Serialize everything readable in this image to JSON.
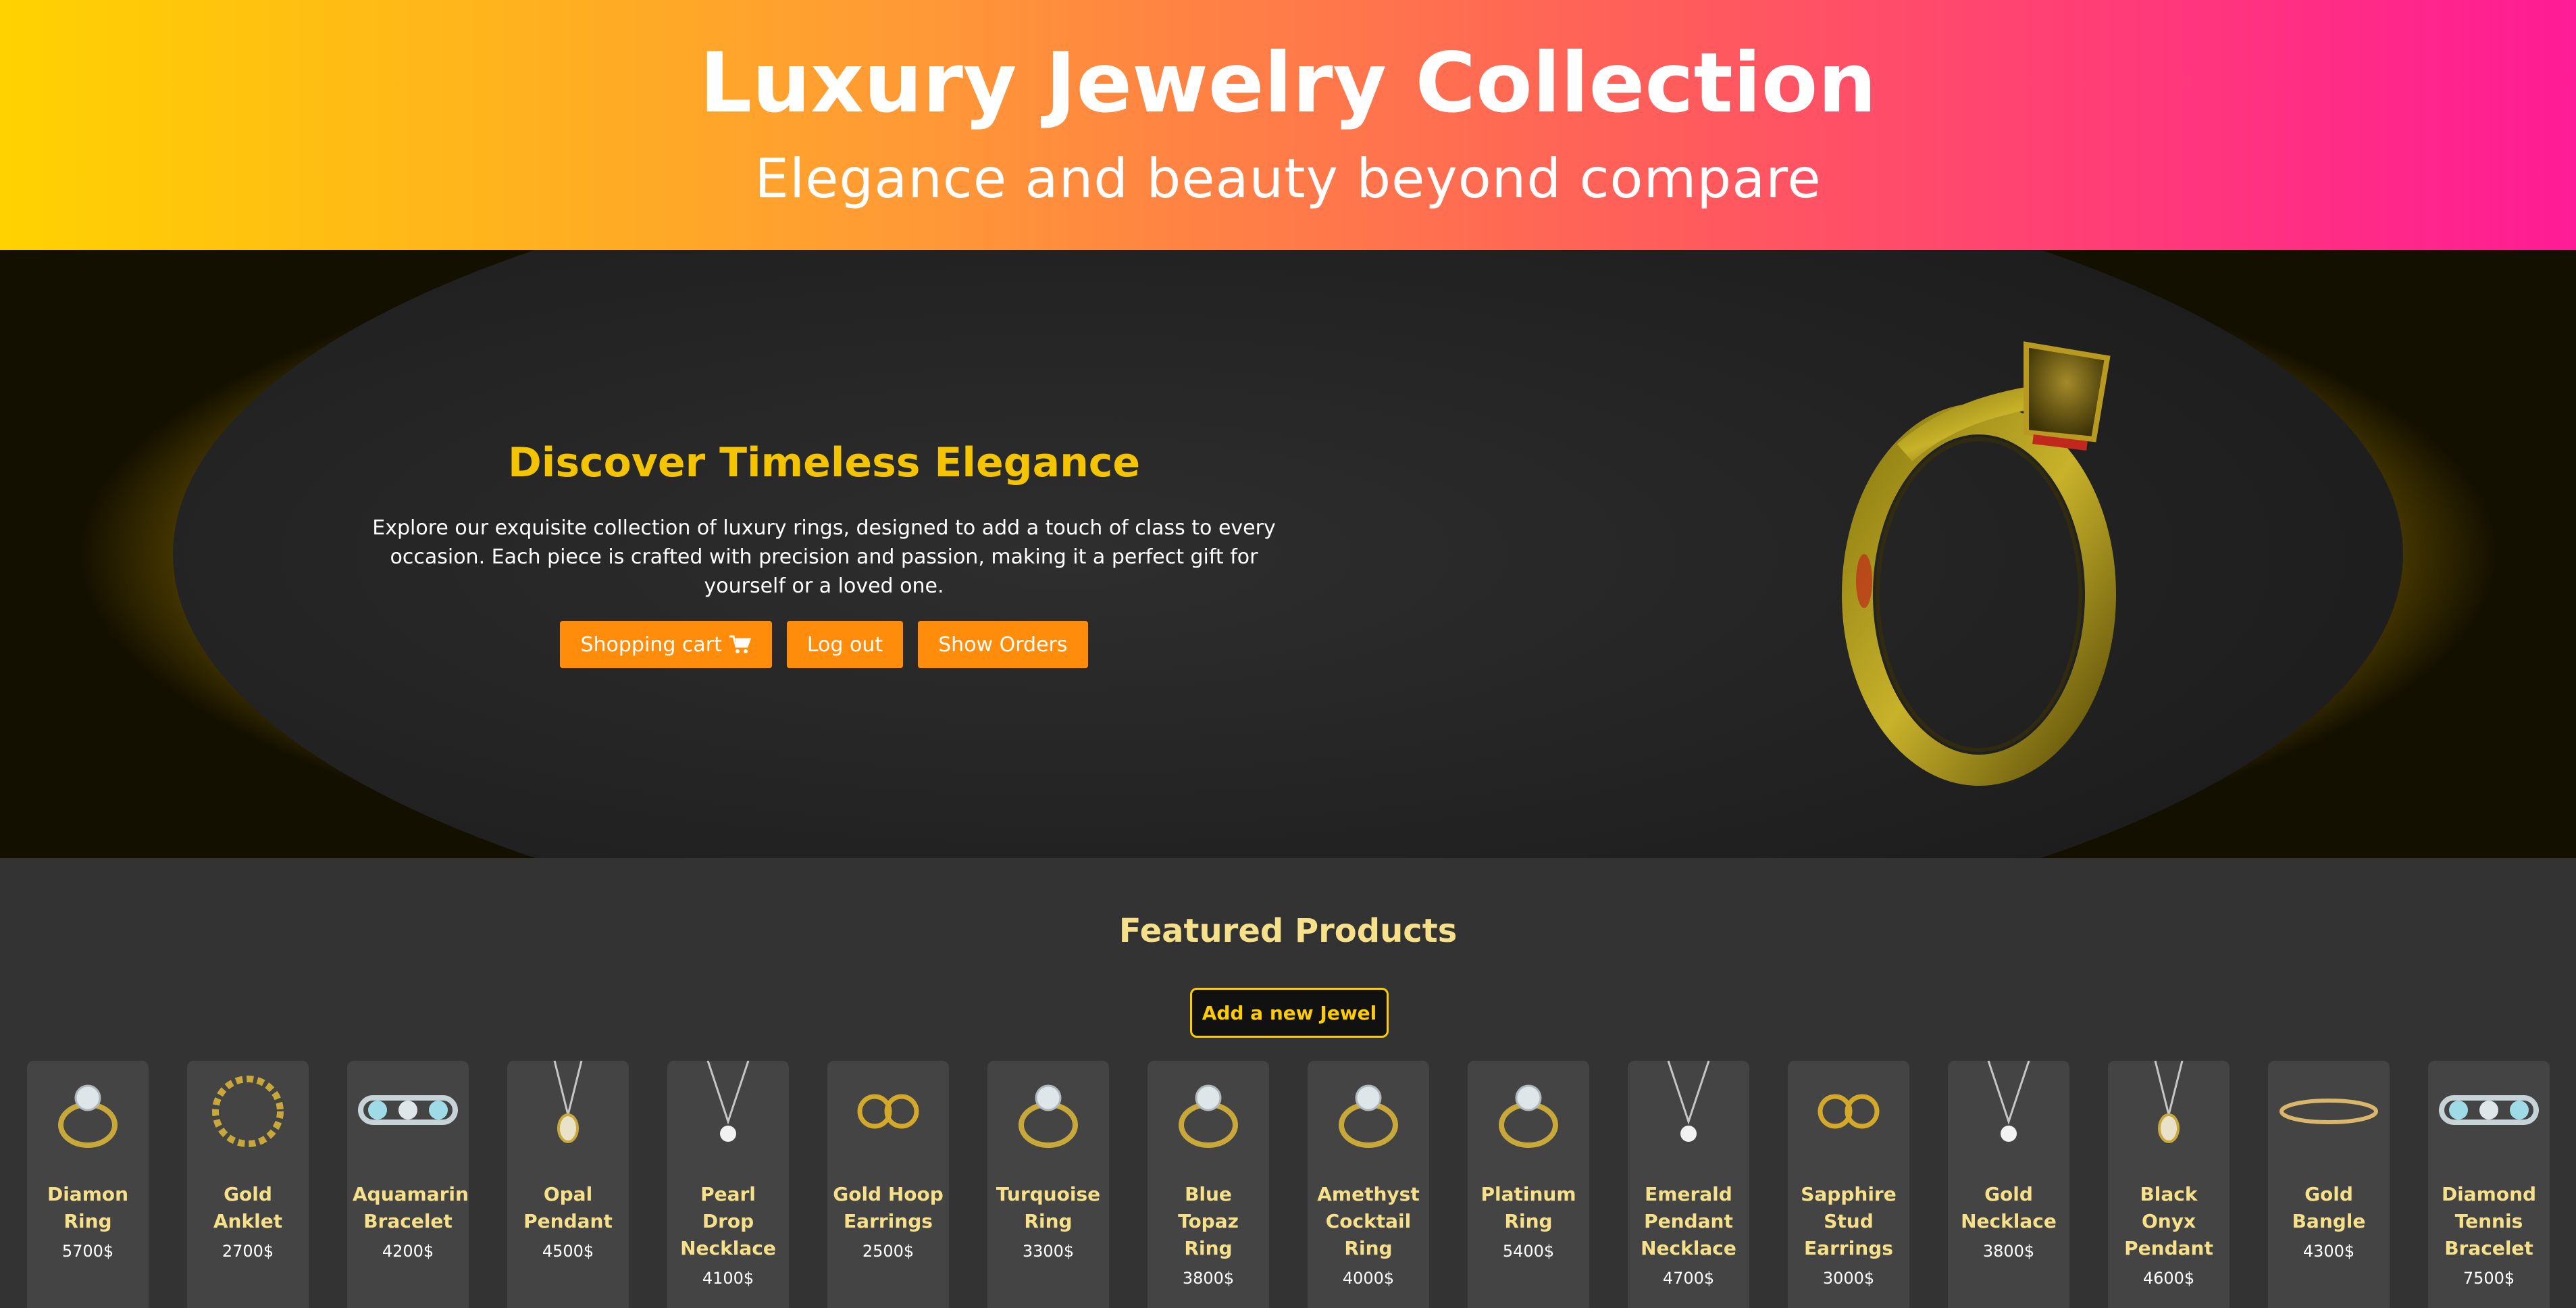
{
  "header": {
    "title": "Luxury Jewelry Collection",
    "subtitle": "Elegance and beauty beyond compare"
  },
  "hero": {
    "title": "Discover Timeless Elegance",
    "text": "Explore our exquisite collection of luxury rings, designed to add a touch of class to every occasion. Each piece is crafted with precision and passion, making it a perfect gift for yourself or a loved one.",
    "buttons": {
      "cart": "Shopping cart",
      "logout": "Log out",
      "orders": "Show Orders"
    },
    "cart_icon": "cart-icon"
  },
  "products": {
    "title": "Featured Products",
    "add_button": "Add a new Jewel",
    "items": [
      {
        "name": "Diamon Ring",
        "price": "5700$",
        "icon": "ring-icon"
      },
      {
        "name": "Gold Anklet",
        "price": "2700$",
        "icon": "anklet-icon"
      },
      {
        "name": "Aquamarine Bracelet",
        "price": "4200$",
        "icon": "bracelet-icon"
      },
      {
        "name": "Opal Pendant",
        "price": "4500$",
        "icon": "pendant-icon"
      },
      {
        "name": "Pearl Drop Necklace",
        "price": "4100$",
        "icon": "necklace-icon"
      },
      {
        "name": "Gold Hoop Earrings",
        "price": "2500$",
        "icon": "earrings-icon"
      },
      {
        "name": "Turquoise Ring",
        "price": "3300$",
        "icon": "ring-icon"
      },
      {
        "name": "Blue Topaz Ring",
        "price": "3800$",
        "icon": "ring-icon"
      },
      {
        "name": "Amethyst Cocktail Ring",
        "price": "4000$",
        "icon": "ring-icon"
      },
      {
        "name": "Platinum Ring",
        "price": "5400$",
        "icon": "ring-icon"
      },
      {
        "name": "Emerald Pendant Necklace",
        "price": "4700$",
        "icon": "necklace-icon"
      },
      {
        "name": "Sapphire Stud Earrings",
        "price": "3000$",
        "icon": "earrings-icon"
      },
      {
        "name": "Gold Necklace",
        "price": "3800$",
        "icon": "necklace-icon"
      },
      {
        "name": "Black Onyx Pendant",
        "price": "4600$",
        "icon": "pendant-icon"
      },
      {
        "name": "Gold Bangle",
        "price": "4300$",
        "icon": "bangle-icon"
      },
      {
        "name": "Diamond Tennis Bracelet",
        "price": "7500$",
        "icon": "bracelet-icon"
      }
    ]
  },
  "colors": {
    "accent": "#ff8c0a",
    "gold": "#f5c400",
    "product_title": "#f7e08a"
  }
}
